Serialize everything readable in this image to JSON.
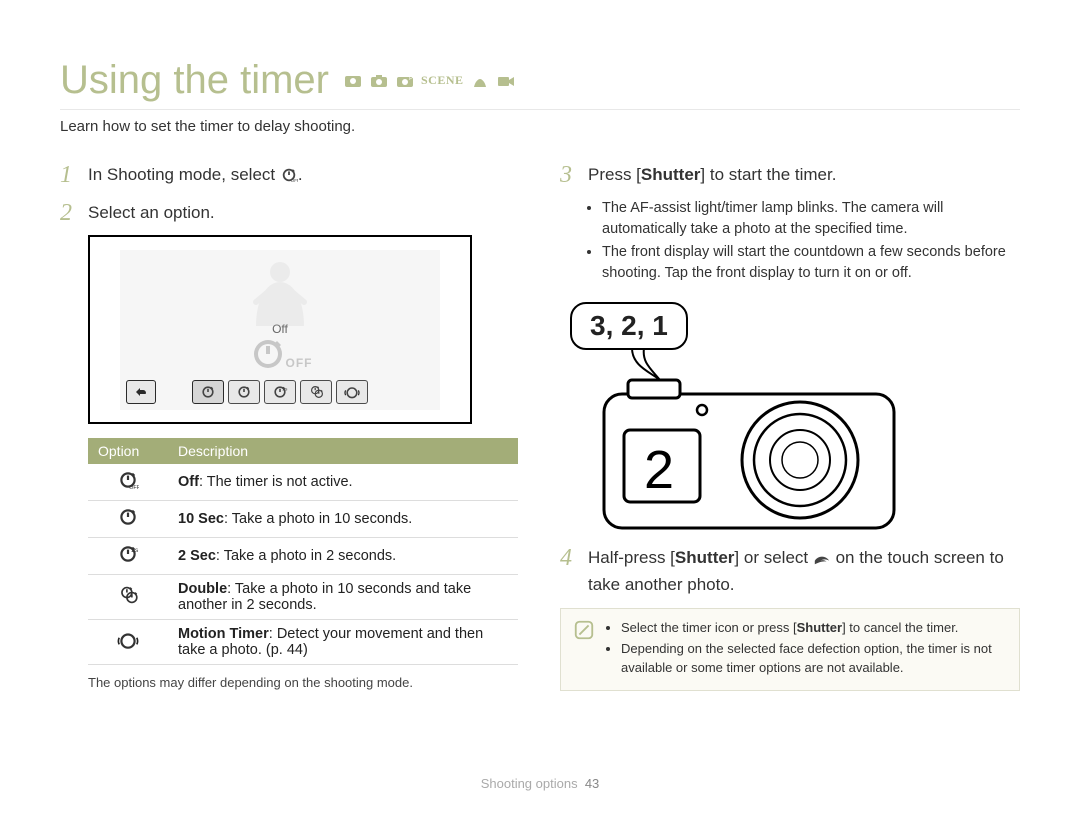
{
  "title": "Using the timer",
  "subtitle": "Learn how to set the timer to delay shooting.",
  "mode_icons": [
    "smart-icon",
    "camera-icon",
    "program-icon",
    "scene-icon",
    "dual-icon",
    "movie-icon"
  ],
  "steps_left": [
    {
      "num": "1",
      "pre": "In Shooting mode, select ",
      "post": "."
    },
    {
      "num": "2",
      "pre": "Select an option.",
      "post": ""
    }
  ],
  "lcd": {
    "label": "Off",
    "big_off_text": "OFF",
    "options": [
      "off",
      "10s",
      "2s",
      "double",
      "motion"
    ]
  },
  "table": {
    "head_option": "Option",
    "head_desc": "Description",
    "rows": [
      {
        "icon": "off",
        "b": "Off",
        "t": ": The timer is not active."
      },
      {
        "icon": "10s",
        "b": "10 Sec",
        "t": ": Take a photo in 10 seconds."
      },
      {
        "icon": "2s",
        "b": "2 Sec",
        "t": ": Take a photo in 2 seconds."
      },
      {
        "icon": "double",
        "b": "Double",
        "t": ": Take a photo in 10 seconds and take another in 2 seconds."
      },
      {
        "icon": "motion",
        "b": "Motion Timer",
        "t": ": Detect your movement and then take a photo. (p. 44)"
      }
    ],
    "footnote": "The options may differ depending on the shooting mode."
  },
  "steps_right": [
    {
      "num": "3",
      "text_parts": [
        "Press [",
        "Shutter",
        "] to start the timer."
      ],
      "bullets": [
        "The AF-assist light/timer lamp blinks. The camera will automatically take a photo at the specified time.",
        "The front display will start the countdown a few seconds before shooting. Tap the front display to turn it on or off."
      ]
    },
    {
      "num": "4",
      "text_parts": [
        "Half-press [",
        "Shutter",
        "] or select ",
        " on the touch screen to take another photo."
      ]
    }
  ],
  "bubble": "3, 2, 1",
  "front_display": "2",
  "note": {
    "items": [
      "Select the timer icon or press [<b>Shutter</b>] to cancel the timer.",
      "Depending on the selected face defection option, the timer is not available or some timer options are not available."
    ]
  },
  "footer": {
    "section": "Shooting options",
    "page": "43"
  }
}
